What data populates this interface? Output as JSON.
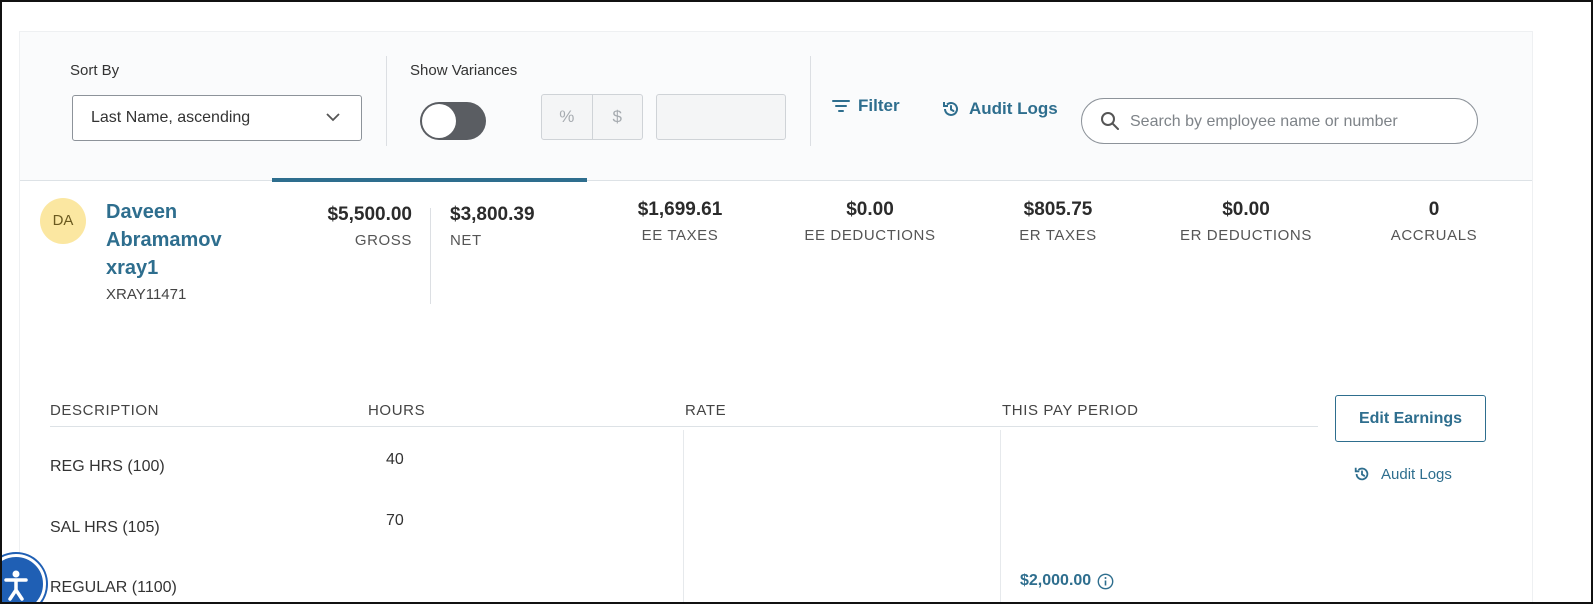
{
  "toolbar": {
    "sort_label": "Sort By",
    "sort_value": "Last Name, ascending",
    "variance_label": "Show Variances",
    "percent_symbol": "%",
    "dollar_symbol": "$",
    "variance_enabled": false,
    "filter_label": "Filter",
    "audit_logs_label": "Audit Logs",
    "search_placeholder": "Search by employee name or number"
  },
  "employee": {
    "initials": "DA",
    "name": "Daveen Abramamov xray1",
    "id": "XRAY11471"
  },
  "summary": [
    {
      "value": "$5,500.00",
      "label": "GROSS"
    },
    {
      "value": "$3,800.39",
      "label": "NET"
    },
    {
      "value": "$1,699.61",
      "label": "EE TAXES"
    },
    {
      "value": "$0.00",
      "label": "EE DEDUCTIONS"
    },
    {
      "value": "$805.75",
      "label": "ER TAXES"
    },
    {
      "value": "$0.00",
      "label": "ER DEDUCTIONS"
    },
    {
      "value": "0",
      "label": "ACCRUALS"
    }
  ],
  "earnings": {
    "columns": [
      "DESCRIPTION",
      "HOURS",
      "RATE",
      "THIS PAY PERIOD"
    ],
    "rows": [
      {
        "description": "REG HRS (100)",
        "hours": "40",
        "rate": "",
        "amount": ""
      },
      {
        "description": "SAL HRS (105)",
        "hours": "70",
        "rate": "",
        "amount": ""
      },
      {
        "description": "REGULAR (1100)",
        "hours": "",
        "rate": "",
        "amount": "$2,000.00"
      }
    ],
    "edit_label": "Edit Earnings",
    "audit_logs_label": "Audit Logs"
  },
  "colors": {
    "accent": "#2e6e8e",
    "avatar_bg": "#fbe7a1",
    "toggle_off": "#5a5d62"
  }
}
